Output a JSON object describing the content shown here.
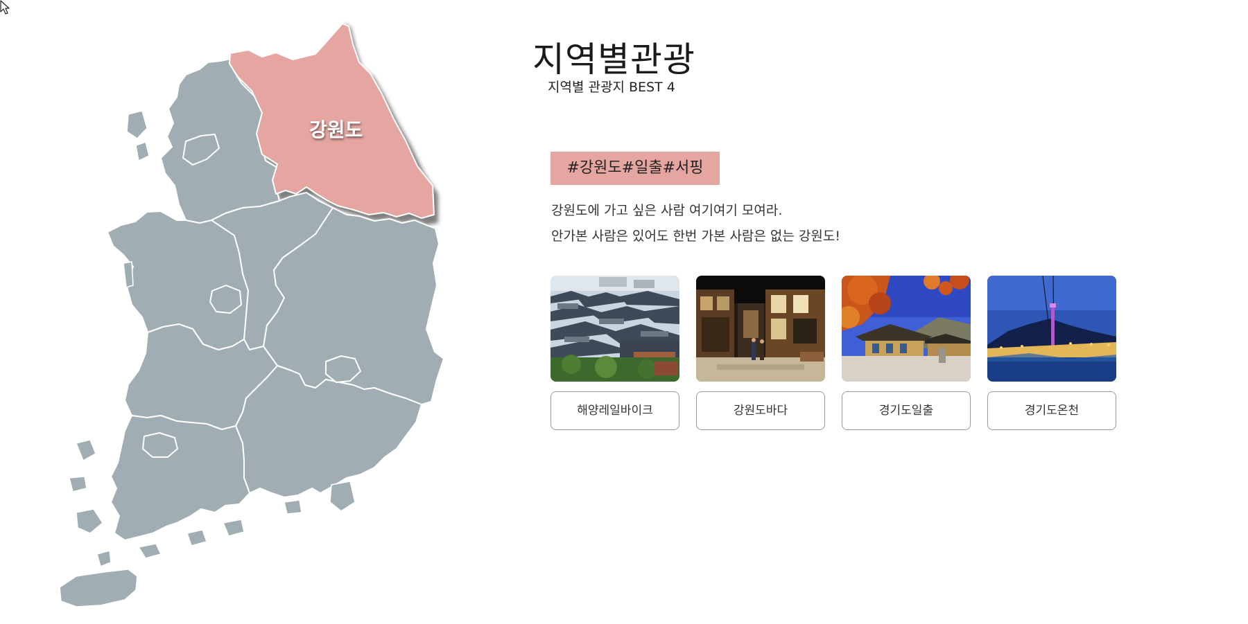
{
  "map": {
    "selected_region": "강원도",
    "colors": {
      "land": "#a0aeb3",
      "selected": "#e5a5a1",
      "border": "#ffffff"
    }
  },
  "header": {
    "title": "지역별관광",
    "subtitle": "지역별 관광지 BEST 4"
  },
  "region_info": {
    "tags": "#강원도#일출#서핑",
    "description": [
      "강원도에 가고 싶은 사람 여기여기 모여라.",
      "안가본 사람은 있어도 한번 가본 사람은 없는 강원도!"
    ]
  },
  "attractions": [
    {
      "label": "해양레일바이크",
      "image": "hanok-village-rooftops"
    },
    {
      "label": "강원도바다",
      "image": "museum-interior-street"
    },
    {
      "label": "경기도일출",
      "image": "temple-autumn-leaves"
    },
    {
      "label": "경기도온천",
      "image": "cable-car-night-city"
    }
  ]
}
